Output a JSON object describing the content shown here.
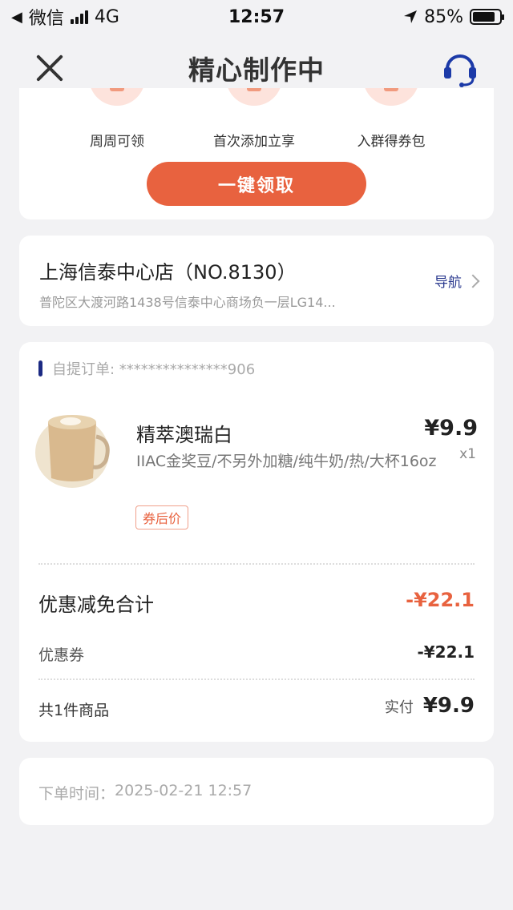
{
  "status_bar": {
    "back_app": "微信",
    "network": "4G",
    "time": "12:57",
    "battery": "85%",
    "battery_level": 0.85
  },
  "nav": {
    "title": "精心制作中",
    "close_icon": "close-icon",
    "service_icon": "headset-icon"
  },
  "perks": [
    {
      "label": "周周可领"
    },
    {
      "label": "首次添加立享"
    },
    {
      "label": "入群得券包"
    }
  ],
  "claim_button": "一键领取",
  "store": {
    "name": "上海信泰中心店（NO.8130）",
    "address": "普陀区大渡河路1438号信泰中心商场负一层LG14...",
    "nav_label": "导航"
  },
  "order": {
    "label": "自提订单: ",
    "number": "***************906",
    "product": {
      "name": "精萃澳瑞白",
      "spec": "IIAC金奖豆/不另外加糖/纯牛奶/热/大杯16oz",
      "tag": "券后价",
      "price": "¥9.9",
      "qty": "x1"
    },
    "discount_title": "优惠减免合计",
    "discount_total": "-¥22.1",
    "coupon_label": "优惠券",
    "coupon_amount": "-¥22.1",
    "count_label": "共1件商品",
    "paid_label": "实付",
    "paid_amount": "¥9.9"
  },
  "order_time": {
    "label": "下单时间：",
    "value": "2025-02-21 12:57"
  },
  "colors": {
    "accent": "#e8623f",
    "nav_link": "#2b3a8f",
    "marker": "#1c2a83"
  }
}
